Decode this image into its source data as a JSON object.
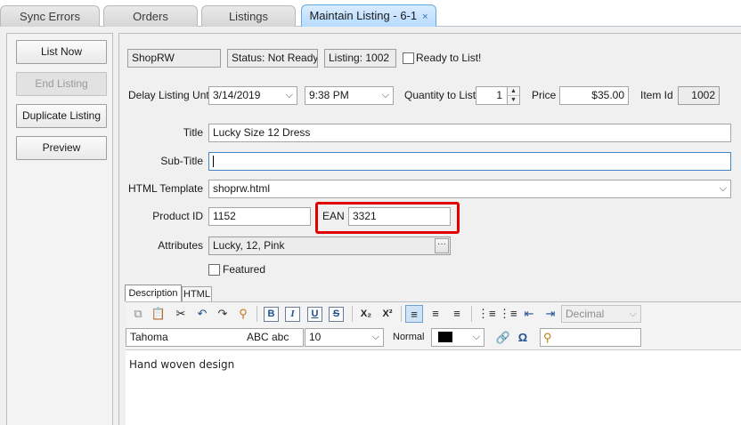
{
  "tabs": [
    {
      "label": "Sync Errors"
    },
    {
      "label": "Orders"
    },
    {
      "label": "Listings"
    },
    {
      "label": "Maintain Listing - 6-1",
      "close": "×"
    }
  ],
  "side_buttons": {
    "list_now": "List Now",
    "end_listing": "End Listing",
    "duplicate_listing": "Duplicate Listing",
    "preview": "Preview"
  },
  "header": {
    "store": "ShopRW",
    "status": "Status: Not Ready",
    "listing": "Listing: 1002",
    "ready_label": "Ready to List!"
  },
  "schedule": {
    "delay_label": "Delay Listing Until",
    "date": "3/14/2019",
    "time": "9:38 PM",
    "quantity_label": "Quantity to List",
    "quantity": "1",
    "price_label": "Price",
    "price": "$35.00",
    "item_id_label": "Item Id",
    "item_id": "1002"
  },
  "form": {
    "title_label": "Title",
    "title": "Lucky Size 12 Dress",
    "subtitle_label": "Sub-Title",
    "subtitle": "",
    "template_label": "HTML Template",
    "template": "shoprw.html",
    "product_id_label": "Product ID",
    "product_id": "1152",
    "ean_label": "EAN",
    "ean": "3321",
    "attributes_label": "Attributes",
    "attributes": "Lucky, 12, Pink",
    "attributes_button": "···",
    "featured_label": "Featured"
  },
  "editor": {
    "tab_description": "Description",
    "tab_html": "HTML",
    "font": "Tahoma",
    "font_preview": "ABC abc",
    "size": "10",
    "style": "Normal",
    "list_format": "Decimal",
    "body_text": "Hand woven design"
  },
  "colors": {
    "accent": "#3f86c9",
    "highlight": "#e00000"
  }
}
